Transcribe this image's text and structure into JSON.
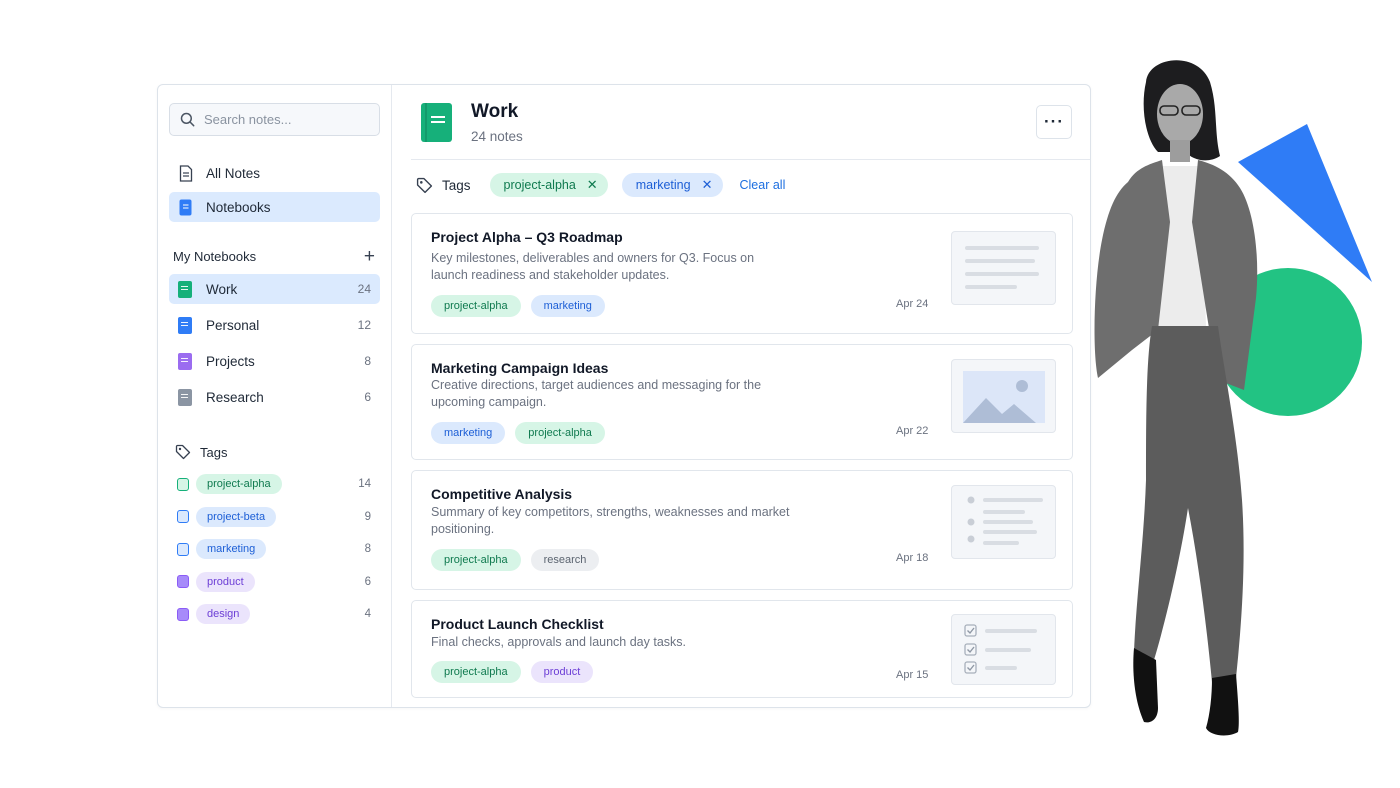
{
  "search": {
    "placeholder": "Search notes..."
  },
  "nav": [
    {
      "label": "All Notes",
      "icon": "document-icon"
    },
    {
      "label": "Notebooks",
      "icon": "notebook-icon"
    }
  ],
  "my_notebooks": {
    "heading": "My Notebooks",
    "add_icon": "plus-icon",
    "items": [
      {
        "label": "Work",
        "count": "24",
        "color": "#16b07a"
      },
      {
        "label": "Personal",
        "count": "12",
        "color": "#2f7cf6"
      },
      {
        "label": "Projects",
        "count": "8",
        "color": "#9b6cf0"
      },
      {
        "label": "Research",
        "count": "6",
        "color": "#8b95a3"
      }
    ]
  },
  "tags": {
    "heading": "Tags",
    "items": [
      {
        "label": "project-alpha",
        "count": "14",
        "style": "green"
      },
      {
        "label": "project-beta",
        "count": "9",
        "style": "blue"
      },
      {
        "label": "marketing",
        "count": "8",
        "style": "blue"
      },
      {
        "label": "product",
        "count": "6",
        "style": "purple"
      },
      {
        "label": "design",
        "count": "4",
        "style": "purple"
      }
    ]
  },
  "header": {
    "title": "Work",
    "subtitle": "24 notes",
    "more_icon": "more-horizontal-icon"
  },
  "filters": {
    "label": "Tags",
    "active": [
      {
        "label": "project-alpha",
        "style": "green"
      },
      {
        "label": "marketing",
        "style": "blue"
      }
    ],
    "clear_label": "Clear all"
  },
  "notes": [
    {
      "title": "Project Alpha – Q3 Roadmap",
      "desc": "Key milestones, deliverables and owners for Q3. Focus on launch readiness and stakeholder updates.",
      "tags": [
        {
          "label": "project-alpha",
          "style": "green"
        },
        {
          "label": "marketing",
          "style": "blue"
        }
      ],
      "date": "Apr 24",
      "thumb": "text-lines-icon"
    },
    {
      "title": "Marketing Campaign Ideas",
      "desc": "Creative directions, target audiences and messaging for the upcoming campaign.",
      "tags": [
        {
          "label": "marketing",
          "style": "blue"
        },
        {
          "label": "project-alpha",
          "style": "green"
        }
      ],
      "date": "Apr 22",
      "thumb": "image-icon"
    },
    {
      "title": "Competitive Analysis",
      "desc": "Summary of key competitors, strengths, weaknesses and market positioning.",
      "tags": [
        {
          "label": "project-alpha",
          "style": "green"
        },
        {
          "label": "research",
          "style": "gray"
        }
      ],
      "date": "Apr 18",
      "thumb": "bullet-list-icon"
    },
    {
      "title": "Product Launch Checklist",
      "desc": "Final checks, approvals and launch day tasks.",
      "tags": [
        {
          "label": "project-alpha",
          "style": "green"
        },
        {
          "label": "product",
          "style": "purple"
        }
      ],
      "date": "Apr 15",
      "thumb": "checklist-icon"
    }
  ],
  "colors": {
    "accent": "#2f7cf6",
    "active_bg": "#dbeafe",
    "green": "#16b07a",
    "triangle": "#2f7cf6",
    "circle": "#22c383"
  }
}
